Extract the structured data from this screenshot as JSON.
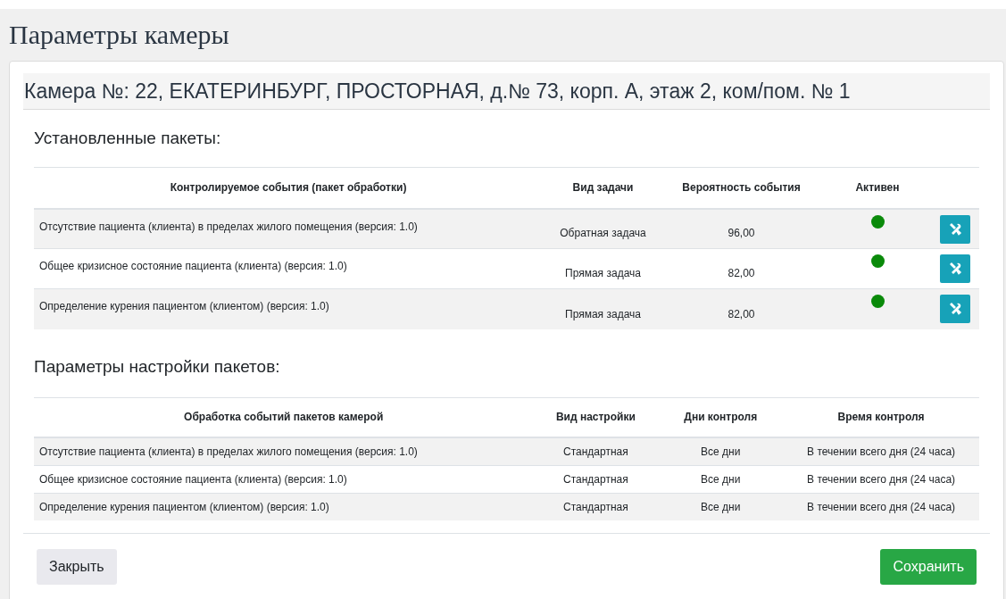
{
  "page_title": "Параметры камеры",
  "camera_header": "Камера №: 22, ЕКАТЕРИНБУРГ, ПРОСТОРНАЯ, д.№ 73, корп. А, этаж 2, ком/пом. № 1",
  "packages": {
    "heading": "Установленные пакеты:",
    "columns": [
      "Контролируемое события (пакет обработки)",
      "Вид задачи",
      "Вероятность события",
      "Активен"
    ],
    "rows": [
      {
        "name": "Отсутствие пациента (клиента) в пределах жилого помещения (версия: 1.0)",
        "task": "Обратная задача",
        "probability": "96,00",
        "active": true
      },
      {
        "name": "Общее кризисное состояние пациента (клиента) (версия: 1.0)",
        "task": "Прямая задача",
        "probability": "82,00",
        "active": true
      },
      {
        "name": "Определение курения пациентом (клиентом) (версия: 1.0)",
        "task": "Прямая задача",
        "probability": "82,00",
        "active": true
      }
    ]
  },
  "settings": {
    "heading": "Параметры настройки пакетов:",
    "columns": [
      "Обработка событий пакетов камерой",
      "Вид настройки",
      "Дни контроля",
      "Время контроля"
    ],
    "rows": [
      [
        "Отсутствие пациента (клиента) в пределах жилого помещения (версия: 1.0)",
        "Стандартная",
        "Все дни",
        "В течении всего дня (24 часа)"
      ],
      [
        "Общее кризисное состояние пациента (клиента) (версия: 1.0)",
        "Стандартная",
        "Все дни",
        "В течении всего дня (24 часа)"
      ],
      [
        "Определение курения пациентом (клиентом) (версия: 1.0)",
        "Стандартная",
        "Все дни",
        "В течении всего дня (24 часа)"
      ]
    ]
  },
  "buttons": {
    "close": "Закрыть",
    "save": "Сохранить"
  }
}
